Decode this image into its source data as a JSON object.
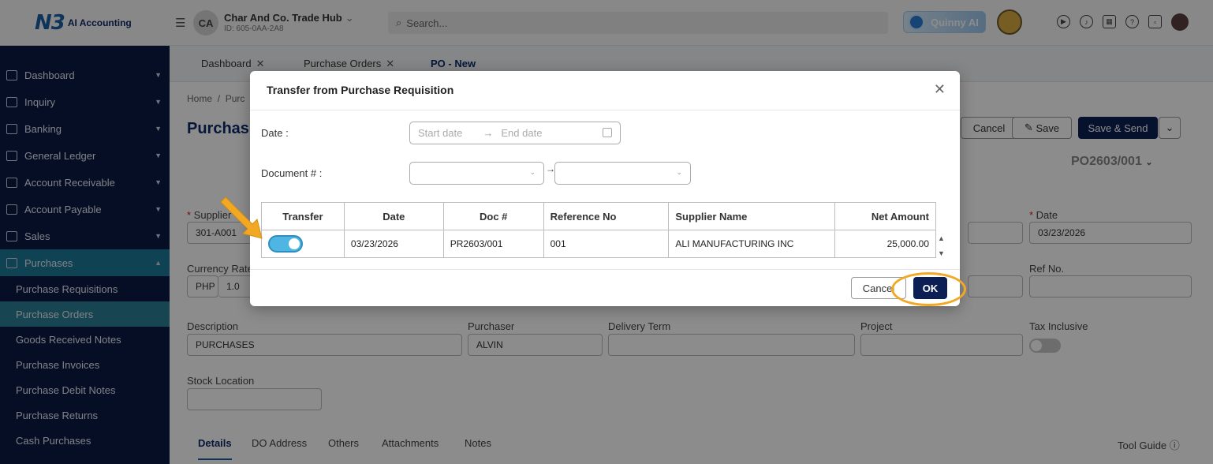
{
  "topbar": {
    "logo_mark": "N3",
    "logo_text": "AI Accounting",
    "company_initials": "CA",
    "company_name": "Char And Co. Trade Hub",
    "company_id": "ID: 605-0AA-2A8",
    "search_placeholder": "Search...",
    "assistant_label": "Quinny AI"
  },
  "sidebar": {
    "items": [
      {
        "label": "Dashboard"
      },
      {
        "label": "Inquiry"
      },
      {
        "label": "Banking"
      },
      {
        "label": "General Ledger"
      },
      {
        "label": "Account Receivable"
      },
      {
        "label": "Account Payable"
      },
      {
        "label": "Sales"
      },
      {
        "label": "Purchases"
      }
    ],
    "sub_items": [
      {
        "label": "Purchase Requisitions"
      },
      {
        "label": "Purchase Orders"
      },
      {
        "label": "Goods Received Notes"
      },
      {
        "label": "Purchase Invoices"
      },
      {
        "label": "Purchase Debit Notes"
      },
      {
        "label": "Purchase Returns"
      },
      {
        "label": "Cash Purchases"
      }
    ]
  },
  "tabs": [
    {
      "label": "Dashboard"
    },
    {
      "label": "Purchase Orders"
    },
    {
      "label": "PO - New"
    }
  ],
  "form": {
    "breadcrumb_home": "Home",
    "breadcrumb_sep": "/",
    "breadcrumb_next": "Purc",
    "title": "Purchas",
    "cancel_label": "Cancel",
    "save_label": "Save",
    "save_send_label": "Save & Send",
    "po_number": "PO2603/001",
    "supplier_label": "Supplier",
    "supplier_value": "301-A001",
    "date_label": "Date",
    "date_value": "03/23/2026",
    "currency_label": "Currency Rate",
    "currency_value": "PHP",
    "rate_value": "1.0",
    "refno_label": "Ref No.",
    "description_label": "Description",
    "description_value": "PURCHASES",
    "purchaser_label": "Purchaser",
    "purchaser_value": "ALVIN",
    "delivery_label": "Delivery Term",
    "project_label": "Project",
    "tax_label": "Tax Inclusive",
    "stock_label": "Stock Location",
    "bottom_tabs": [
      "Details",
      "DO Address",
      "Others",
      "Attachments",
      "Notes"
    ],
    "tool_guide": "Tool Guide"
  },
  "modal": {
    "title": "Transfer from Purchase Requisition",
    "date_label": "Date :",
    "start_placeholder": "Start date",
    "end_placeholder": "End date",
    "doc_label": "Document # :",
    "columns": [
      "Transfer",
      "Date",
      "Doc #",
      "Reference No",
      "Supplier Name",
      "Net Amount"
    ],
    "rows": [
      {
        "transfer": true,
        "date": "03/23/2026",
        "doc": "PR2603/001",
        "ref": "001",
        "supplier": "ALI MANUFACTURING INC",
        "amount": "25,000.00"
      }
    ],
    "cancel_label": "Cancel",
    "ok_label": "OK"
  }
}
